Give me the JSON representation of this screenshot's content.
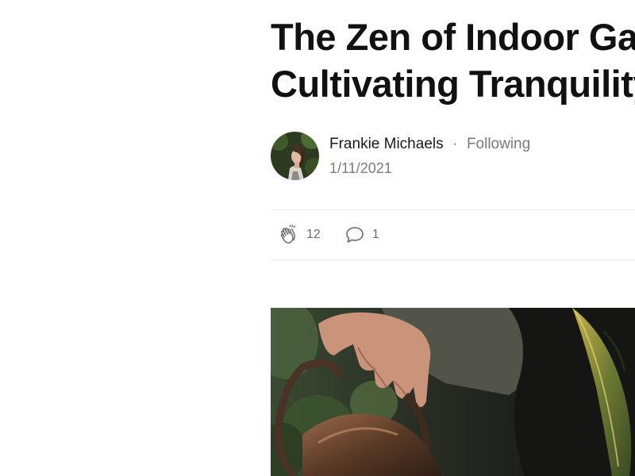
{
  "article": {
    "title_line1": "The Zen of Indoor Gardening:",
    "title_line2": "Cultivating Tranquility"
  },
  "author": {
    "name": "Frankie Michaels",
    "follow_status": "Following",
    "date": "1/11/2021",
    "separator": "·"
  },
  "actions": {
    "claps": "12",
    "comments": "1",
    "clap_icon": "clap-icon",
    "comment_icon": "comment-bubble-icon"
  },
  "colors": {
    "text": "#111111",
    "muted": "#7b7b7b",
    "divider": "#ececec"
  }
}
